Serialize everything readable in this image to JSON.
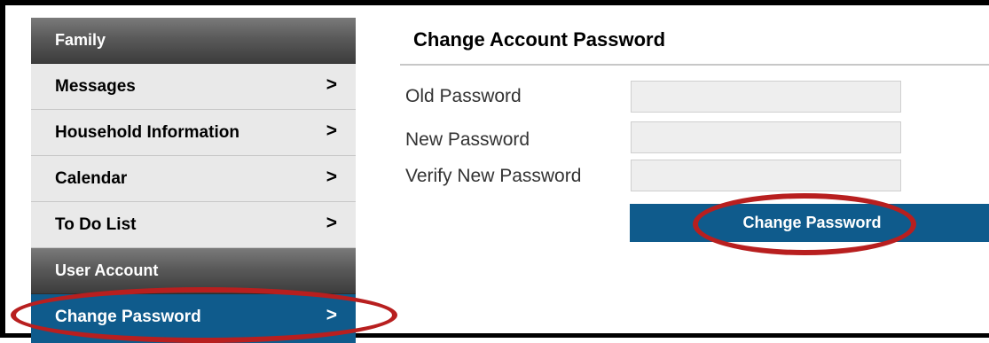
{
  "sidebar": {
    "family_header": "Family",
    "items": [
      {
        "label": "Messages",
        "chevron": ">"
      },
      {
        "label": "Household Information",
        "chevron": ">"
      },
      {
        "label": "Calendar",
        "chevron": ">"
      },
      {
        "label": "To Do List",
        "chevron": ">"
      }
    ],
    "account_header": "User Account",
    "active_item": {
      "label": "Change Password",
      "chevron": ">"
    }
  },
  "main": {
    "title": "Change Account Password",
    "fields": [
      {
        "label": "Old Password",
        "value": ""
      },
      {
        "label": "New Password",
        "value": ""
      },
      {
        "label": "Verify New Password",
        "value": ""
      }
    ],
    "submit_label": "Change Password"
  },
  "colors": {
    "accent_blue": "#0f5b8c",
    "highlight_red": "#b81f1f",
    "sidebar_item_bg": "#e9e9e9",
    "input_bg": "#eeeeee"
  },
  "icons": {
    "chevron": "chevron-right-icon"
  }
}
